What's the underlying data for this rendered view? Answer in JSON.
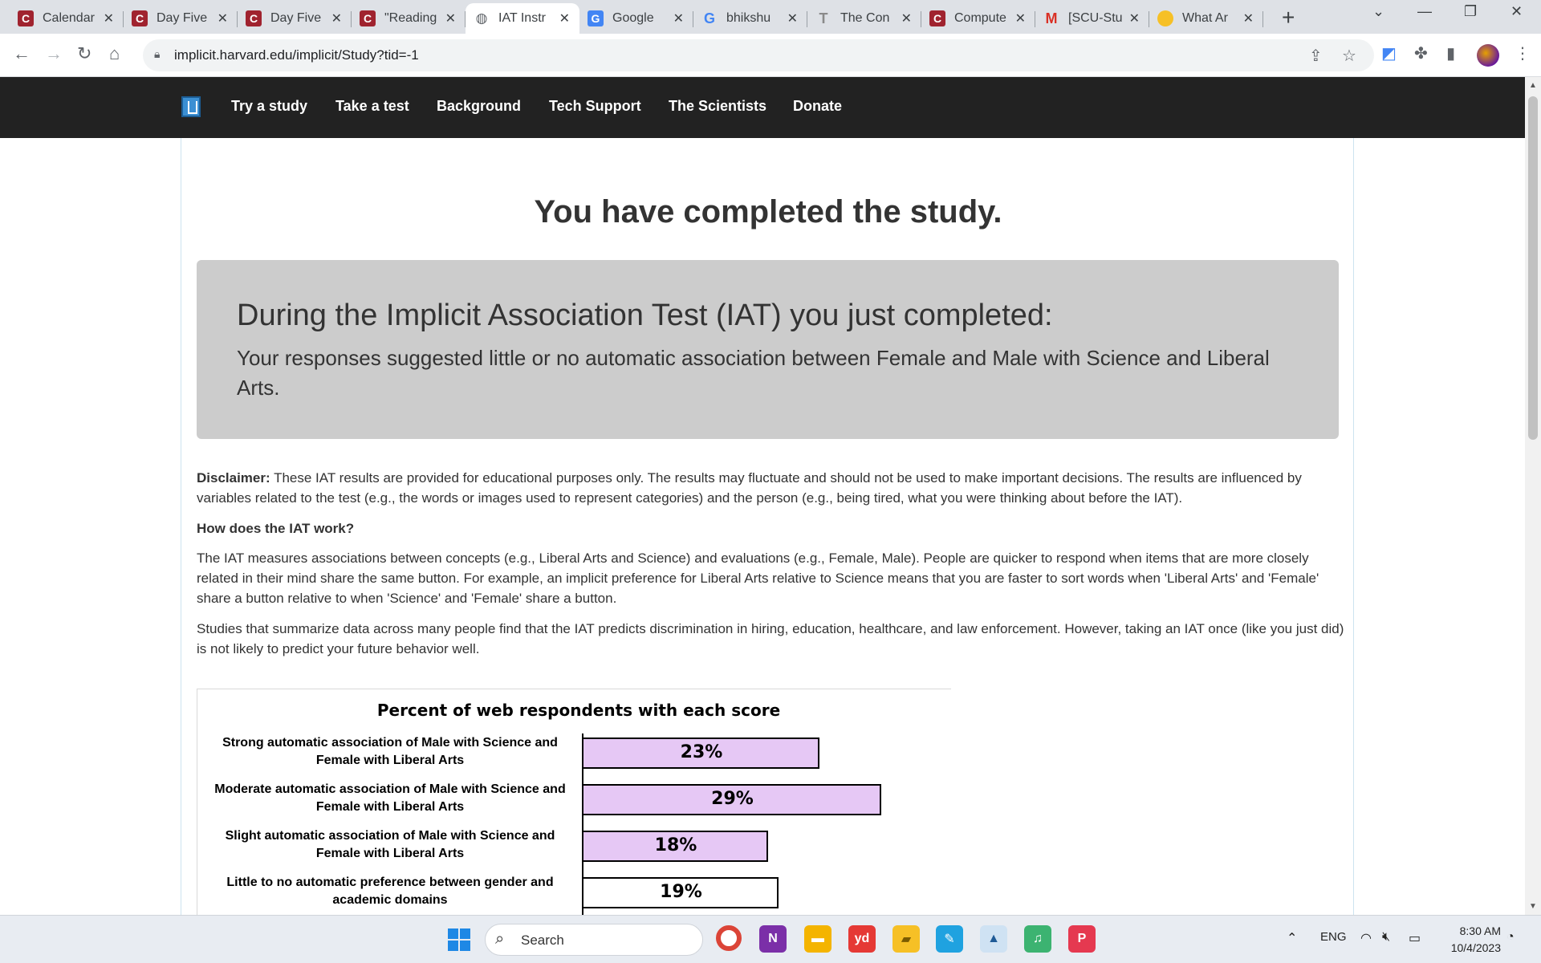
{
  "browser": {
    "tabs": [
      {
        "title": "Calendar",
        "icon": "canvas-icon",
        "color": "#a0232f"
      },
      {
        "title": "Day Five",
        "icon": "canvas-icon",
        "color": "#a0232f"
      },
      {
        "title": "Day Five",
        "icon": "canvas-icon",
        "color": "#a0232f"
      },
      {
        "title": "\"Reading",
        "icon": "canvas-icon",
        "color": "#a0232f"
      },
      {
        "title": "IAT Instr",
        "icon": "globe-icon",
        "color": "#5f6368"
      },
      {
        "title": "Google",
        "icon": "google-translate-icon",
        "color": "#4285f4"
      },
      {
        "title": "bhikshu",
        "icon": "google-icon",
        "color": "#ffffff"
      },
      {
        "title": "The Con",
        "icon": "tumblr-icon",
        "color": "#8a8a8a"
      },
      {
        "title": "Compute",
        "icon": "canvas-icon",
        "color": "#a0232f"
      },
      {
        "title": "[SCU-Stu",
        "icon": "gmail-icon",
        "color": "#ffffff"
      },
      {
        "title": "What Ar",
        "icon": "emoji-icon",
        "color": "#f6c026"
      }
    ],
    "active_tab": 4,
    "url": "implicit.harvard.edu/implicit/Study?tid=-1"
  },
  "site_nav": {
    "links": [
      "Try a study",
      "Take a test",
      "Background",
      "Tech Support",
      "The Scientists",
      "Donate"
    ]
  },
  "page": {
    "heading": "You have completed the study.",
    "result_heading": "During the Implicit Association Test (IAT) you just completed:",
    "result_text": "Your responses suggested little or no automatic association between Female and Male with Science and Liberal Arts.",
    "disclaimer_label": "Disclaimer:",
    "disclaimer_text": " These IAT results are provided for educational purposes only. The results may fluctuate and should not be used to make important decisions. The results are influenced by variables related to the test (e.g., the words or images used to represent categories) and the person (e.g., being tired, what you were thinking about before the IAT).",
    "how_heading": "How does the IAT work?",
    "how_text": "The IAT measures associations between concepts (e.g., Liberal Arts and Science) and evaluations (e.g., Female, Male). People are quicker to respond when items that are more closely related in their mind share the same button. For example, an implicit preference for Liberal Arts relative to Science means that you are faster to sort words when 'Liberal Arts' and 'Female' share a button relative to when 'Science' and 'Female' share a button.",
    "studies_text": "Studies that summarize data across many people find that the IAT predicts discrimination in hiring, education, healthcare, and law enforcement. However, taking an IAT once (like you just did) is not likely to predict your future behavior well."
  },
  "chart_data": {
    "type": "bar",
    "orientation": "horizontal",
    "title": "Percent of web respondents with each score",
    "categories": [
      "Strong automatic association of Male with Science and Female with Liberal Arts",
      "Moderate automatic association of Male with Science and Female with Liberal Arts",
      "Slight automatic association of Male with Science and Female with Liberal Arts",
      "Little to no automatic preference between gender and academic domains"
    ],
    "values": [
      23,
      29,
      18,
      19
    ],
    "value_labels": [
      "23%",
      "29%",
      "18%",
      "19%"
    ],
    "bar_colors": [
      "#e6c8f5",
      "#e6c8f5",
      "#e6c8f5",
      "#ffffff"
    ],
    "xlabel": "",
    "ylabel": ""
  },
  "taskbar": {
    "search_placeholder": "Search",
    "language": "ENG",
    "time": "8:30 AM",
    "date": "10/4/2023"
  }
}
